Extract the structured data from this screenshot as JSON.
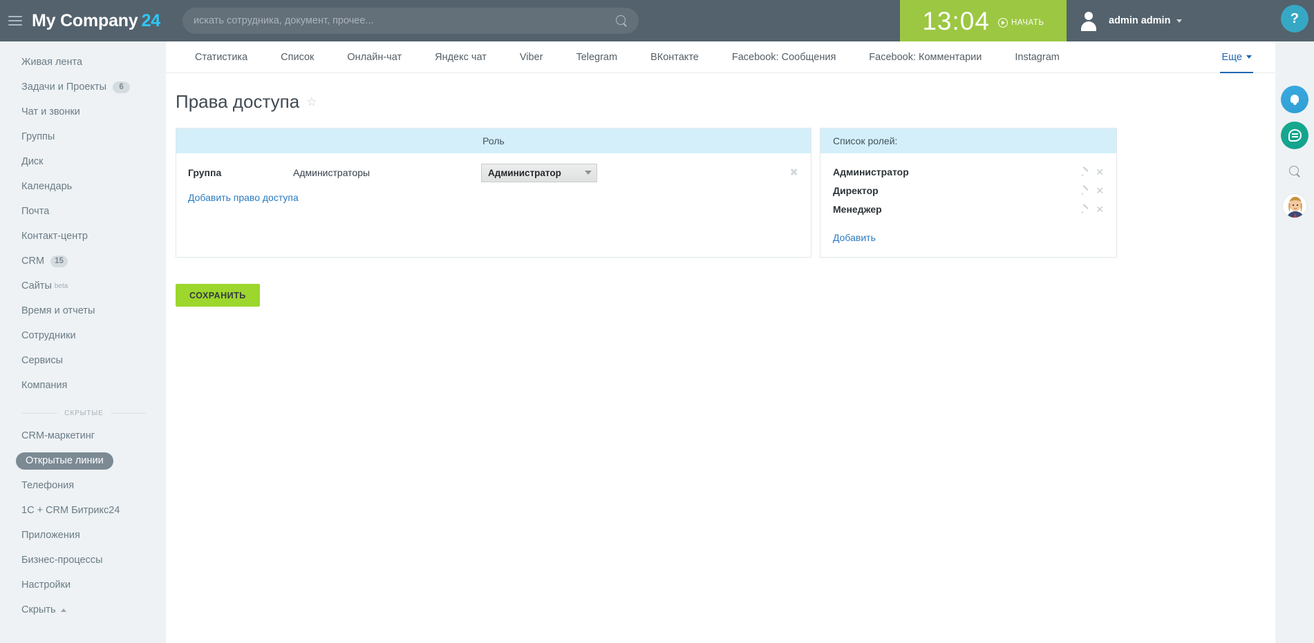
{
  "topbar": {
    "brand_name": "My Company",
    "brand_suffix": "24",
    "search_placeholder": "искать сотрудника, документ, прочее...",
    "search_value": "",
    "clock_time": "13:04",
    "clock_start_label": "НАЧАТЬ",
    "user_name": "admin admin",
    "help_label": "?"
  },
  "sidebar": {
    "items": [
      {
        "label": "Живая лента",
        "badge": "",
        "active": false
      },
      {
        "label": "Задачи и Проекты",
        "badge": "6",
        "active": false
      },
      {
        "label": "Чат и звонки",
        "badge": "",
        "active": false
      },
      {
        "label": "Группы",
        "badge": "",
        "active": false
      },
      {
        "label": "Диск",
        "badge": "",
        "active": false
      },
      {
        "label": "Календарь",
        "badge": "",
        "active": false
      },
      {
        "label": "Почта",
        "badge": "",
        "active": false
      },
      {
        "label": "Контакт-центр",
        "badge": "",
        "active": false
      },
      {
        "label": "CRM",
        "badge": "15",
        "active": false
      },
      {
        "label": "Сайты",
        "badge": "",
        "beta": "beta",
        "active": false
      },
      {
        "label": "Время и отчеты",
        "badge": "",
        "active": false
      },
      {
        "label": "Сотрудники",
        "badge": "",
        "active": false
      },
      {
        "label": "Сервисы",
        "badge": "",
        "active": false
      },
      {
        "label": "Компания",
        "badge": "",
        "active": false
      }
    ],
    "hidden_separator_label": "СКРЫТЫЕ",
    "hidden_items": [
      {
        "label": "CRM-маркетинг",
        "active": false
      },
      {
        "label": "Открытые линии",
        "active": true
      },
      {
        "label": "Телефония",
        "active": false
      },
      {
        "label": "1С + CRM Битрикс24",
        "active": false
      },
      {
        "label": "Приложения",
        "active": false
      },
      {
        "label": "Бизнес-процессы",
        "active": false
      },
      {
        "label": "Настройки",
        "active": false
      }
    ],
    "collapse_label": "Скрыть"
  },
  "tabs": [
    {
      "label": "Статистика",
      "active": false
    },
    {
      "label": "Список",
      "active": false
    },
    {
      "label": "Онлайн-чат",
      "active": false
    },
    {
      "label": "Яндекс чат",
      "active": false
    },
    {
      "label": "Viber",
      "active": false
    },
    {
      "label": "Telegram",
      "active": false
    },
    {
      "label": "ВКонтакте",
      "active": false
    },
    {
      "label": "Facebook: Сообщения",
      "active": false
    },
    {
      "label": "Facebook: Комментарии",
      "active": false
    },
    {
      "label": "Instagram",
      "active": false
    }
  ],
  "tab_more": {
    "label": "Еще",
    "active": true
  },
  "page": {
    "title": "Права доступа",
    "star": "☆"
  },
  "permissions_panel": {
    "header": "Роль",
    "rows": [
      {
        "type_label": "Группа",
        "name": "Администраторы",
        "role_value": "Администратор",
        "delete_glyph": "✖"
      }
    ],
    "add_link": "Добавить право доступа"
  },
  "roles_panel": {
    "header": "Список ролей:",
    "roles": [
      {
        "name": "Администратор",
        "edit_glyph": "",
        "delete_glyph": "✕"
      },
      {
        "name": "Директор",
        "edit_glyph": "",
        "delete_glyph": "✕"
      },
      {
        "name": "Менеджер",
        "edit_glyph": "",
        "delete_glyph": "✕"
      }
    ],
    "add_link": "Добавить"
  },
  "actions": {
    "save_label": "СОХРАНИТЬ"
  },
  "colors": {
    "topbar_bg": "#53626d",
    "brand_accent": "#2fc7f7",
    "clock_bg": "#9cc742",
    "tab_active": "#2067b0",
    "panel_header_bg": "#d4effa",
    "save_btn_bg": "#9dd62c",
    "sidebar_active_pill": "#7c8a94"
  }
}
